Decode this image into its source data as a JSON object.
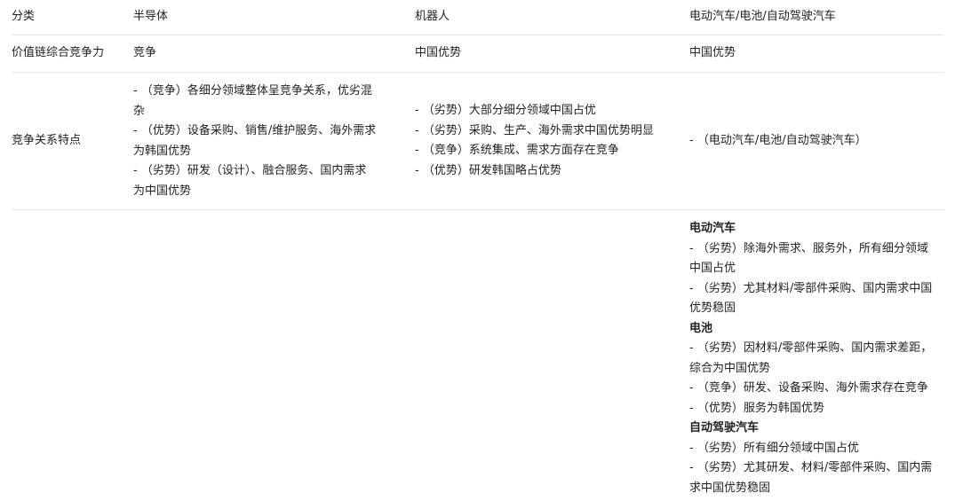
{
  "header": {
    "category": "分类",
    "semiconductor": "半导体",
    "robot": "机器人",
    "ev": "电动汽车/电池/自动驾驶汽车"
  },
  "row_value_chain": {
    "label": "价值链综合竞争力",
    "semiconductor": "竞争",
    "robot": "中国优势",
    "ev": "中国优势"
  },
  "row_features": {
    "label": "竞争关系特点",
    "semiconductor": [
      "- （竞争）各细分领域整体呈竞争关系，优劣混",
      "杂",
      "- （优势）设备采购、销售/维护服务、海外需求",
      "为韩国优势",
      "- （劣势）研发（设计）、融合服务、国内需求",
      "为中国优势"
    ],
    "robot": [
      "- （劣势）大部分细分领域中国占优",
      "- （劣势）采购、生产、海外需求中国优势明显",
      "- （竞争）系统集成、需求方面存在竞争",
      "- （优势）研发韩国略占优势"
    ],
    "ev": "- （电动汽车/电池/自动驾驶汽车）"
  },
  "row_detail": {
    "ev": [
      {
        "text": "电动汽车",
        "bold": true
      },
      {
        "text": "- （劣势）除海外需求、服务外，所有细分领域",
        "bold": false
      },
      {
        "text": "中国占优",
        "bold": false
      },
      {
        "text": "- （劣势）尤其材料/零部件采购、国内需求中国",
        "bold": false
      },
      {
        "text": "优势稳固",
        "bold": false
      },
      {
        "text": "电池",
        "bold": true
      },
      {
        "text": "- （劣势）因材料/零部件采购、国内需求差距，",
        "bold": false
      },
      {
        "text": "综合为中国优势",
        "bold": false
      },
      {
        "text": "- （竞争）研发、设备采购、海外需求存在竞争",
        "bold": false
      },
      {
        "text": "- （优势）服务为韩国优势",
        "bold": false
      },
      {
        "text": "自动驾驶汽车",
        "bold": true
      },
      {
        "text": "- （劣势）所有细分领域中国占优",
        "bold": false
      },
      {
        "text": "- （劣势）尤其研发、材料/零部件采购、国内需",
        "bold": false
      },
      {
        "text": "求中国优势稳固",
        "bold": false
      }
    ]
  }
}
